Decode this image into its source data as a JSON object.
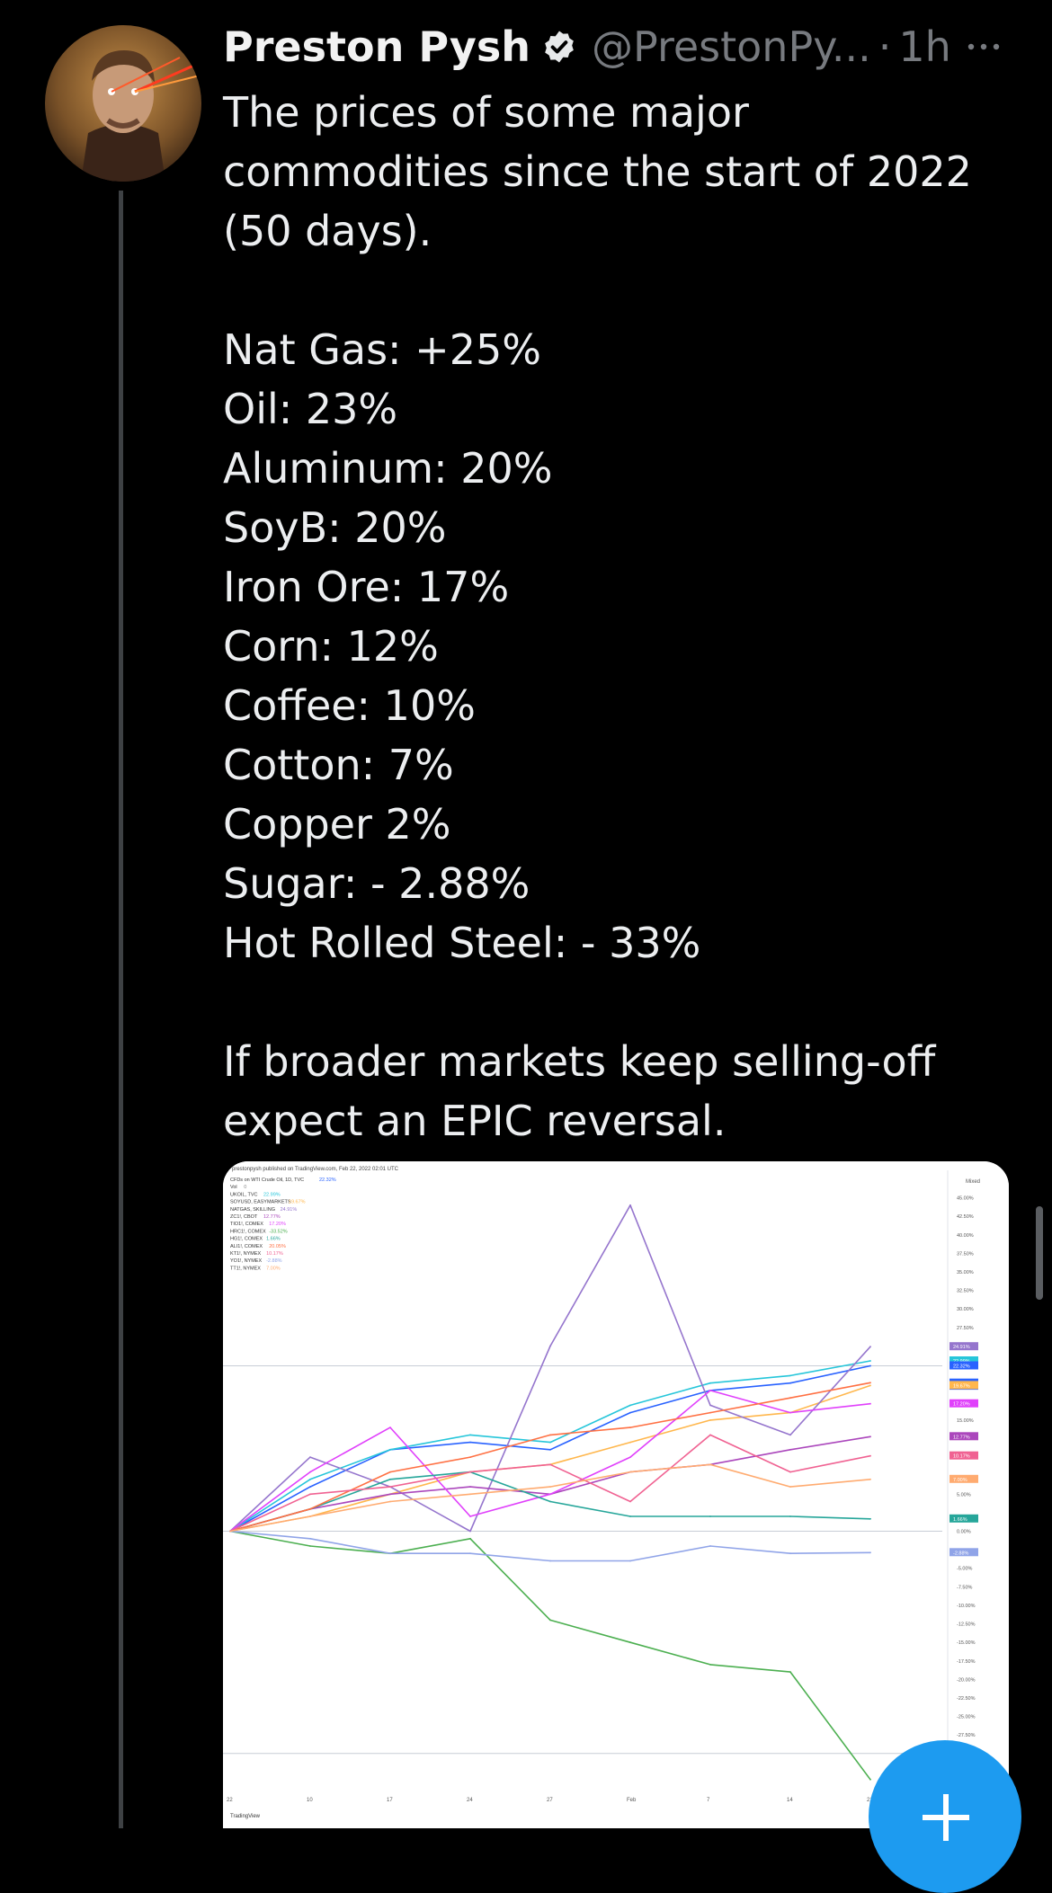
{
  "tweet": {
    "author_name": "Preston Pysh",
    "handle": "@PrestonPy...",
    "separator": "·",
    "time": "1h",
    "text_lines": [
      "The prices of some major",
      "commodities since the start of 2022",
      "(50 days).",
      "",
      "Nat Gas: +25%",
      "Oil: 23%",
      "Aluminum: 20%",
      "SoyB: 20%",
      "Iron Ore: 17%",
      "Corn: 12%",
      "Coffee: 10%",
      "Cotton: 7%",
      "Copper 2%",
      "Sugar: - 2.88%",
      "Hot Rolled Steel: - 33%",
      "",
      "If broader markets keep selling-off",
      "expect an EPIC reversal."
    ]
  },
  "icons": {
    "verified": "verified-badge-icon",
    "more": "more-horizontal-icon",
    "compose": "plus-icon"
  },
  "colors": {
    "accent": "#1d9bf0",
    "background": "#000000",
    "text": "#e7e9ea",
    "secondary_text": "#71767b"
  },
  "chart": {
    "header": "prestonpysh published on TradingView.com, Feb 22, 2022 02:01 UTC",
    "watermark": "TradingView",
    "axis_top_label": "Mixed",
    "legend": [
      {
        "label": "CFDs on WTI Crude Oil, 1D, TVC",
        "value": "22.32%",
        "color": "#2962ff"
      },
      {
        "label": "Vol",
        "value": "0",
        "color": "#888888"
      },
      {
        "label": "UKOIL, TVC",
        "value": "22.99%",
        "color": "#26c6da"
      },
      {
        "label": "SOYUSD, EASYMARKETS",
        "value": "19.67%",
        "color": "#ffb74d"
      },
      {
        "label": "NATGAS, SKILLING",
        "value": "24.91%",
        "color": "#9575cd"
      },
      {
        "label": "ZC1!, CBOT",
        "value": "12.77%",
        "color": "#ab47bc"
      },
      {
        "label": "TIO1!, COMEX",
        "value": "17.20%",
        "color": "#e040fb"
      },
      {
        "label": "HRC1!, COMEX",
        "value": "-33.52%",
        "color": "#4caf50"
      },
      {
        "label": "HG1!, COMEX",
        "value": "1.66%",
        "color": "#26a69a"
      },
      {
        "label": "ALI1!, COMEX",
        "value": "20.05%",
        "color": "#ff7043"
      },
      {
        "label": "KT1!, NYMEX",
        "value": "10.17%",
        "color": "#f06292"
      },
      {
        "label": "YO1!, NYMEX",
        "value": "-2.88%",
        "color": "#90a4e8"
      },
      {
        "label": "TT1!, NYMEX",
        "value": "7.00%",
        "color": "#ffab70"
      }
    ],
    "y_ticks": [
      "45.00%",
      "42.50%",
      "40.00%",
      "37.50%",
      "35.00%",
      "32.50%",
      "30.00%",
      "27.50%",
      "15.00%",
      "5.00%",
      "0.00%",
      "-5.00%",
      "-7.50%",
      "-10.00%",
      "-12.50%",
      "-15.00%",
      "-17.50%",
      "-20.00%",
      "-22.50%",
      "-25.00%",
      "-27.50%",
      "-30.00%",
      "-35.00%"
    ],
    "badges": [
      "24.91%",
      "22.99%",
      "22.32%",
      "19.58.51",
      "20.0%",
      "19.67%",
      "17.20%",
      "12.77%",
      "10.17%",
      "7.00%",
      "1.66%",
      "-2.88%",
      "-33.52%"
    ],
    "x_ticks": [
      "22",
      "10",
      "17",
      "24",
      "27",
      "Feb",
      "7",
      "14",
      "21"
    ]
  },
  "chart_data": {
    "type": "line",
    "title": "",
    "xlabel": "",
    "ylabel": "",
    "ylim": [
      -35,
      47.5
    ],
    "x": [
      "Jan 3",
      "Jan 10",
      "Jan 17",
      "Jan 24",
      "Jan 27",
      "Feb 1",
      "Feb 7",
      "Feb 14",
      "Feb 21"
    ],
    "series": [
      {
        "name": "CFDs on WTI Crude Oil, 1D, TVC",
        "color": "#2962ff",
        "values": [
          0,
          6,
          11,
          12,
          11,
          16,
          19,
          20,
          22.32
        ]
      },
      {
        "name": "UKOIL, TVC",
        "color": "#26c6da",
        "values": [
          0,
          7,
          11,
          13,
          12,
          17,
          20,
          21,
          22.99
        ]
      },
      {
        "name": "SOYUSD, EASYMARKETS",
        "color": "#ffb74d",
        "values": [
          0,
          2,
          5,
          8,
          9,
          12,
          15,
          16,
          19.67
        ]
      },
      {
        "name": "NATGAS, SKILLING",
        "color": "#9575cd",
        "values": [
          0,
          10,
          6,
          0,
          25,
          44,
          17,
          13,
          24.91
        ]
      },
      {
        "name": "ZC1!, CBOT",
        "color": "#ab47bc",
        "values": [
          0,
          3,
          5,
          6,
          5,
          8,
          9,
          11,
          12.77
        ]
      },
      {
        "name": "TIO1!, COMEX",
        "color": "#e040fb",
        "values": [
          0,
          8,
          14,
          2,
          5,
          10,
          19,
          16,
          17.2
        ]
      },
      {
        "name": "HRC1!, COMEX",
        "color": "#4caf50",
        "values": [
          0,
          -2,
          -3,
          -1,
          -12,
          -15,
          -18,
          -19,
          -33.52
        ]
      },
      {
        "name": "HG1!, COMEX",
        "color": "#26a69a",
        "values": [
          0,
          3,
          7,
          8,
          4,
          2,
          2,
          2,
          1.66
        ]
      },
      {
        "name": "ALI1!, COMEX",
        "color": "#ff7043",
        "values": [
          0,
          3,
          8,
          10,
          13,
          14,
          16,
          18,
          20.05
        ]
      },
      {
        "name": "KT1!, NYMEX",
        "color": "#f06292",
        "values": [
          0,
          5,
          6,
          8,
          9,
          4,
          13,
          8,
          10.17
        ]
      },
      {
        "name": "YO1!, NYMEX",
        "color": "#90a4e8",
        "values": [
          0,
          -1,
          -3,
          -3,
          -4,
          -4,
          -2,
          -3,
          -2.88
        ]
      },
      {
        "name": "TT1!, NYMEX",
        "color": "#ffab70",
        "values": [
          0,
          2,
          4,
          5,
          6,
          8,
          9,
          6,
          7.0
        ]
      }
    ]
  }
}
